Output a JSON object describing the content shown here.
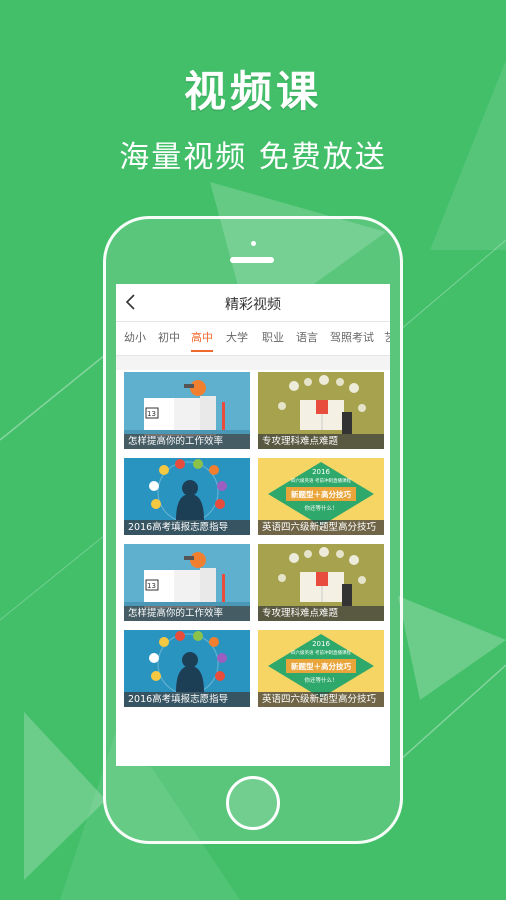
{
  "promo": {
    "headline": "视频课",
    "subhead": "海量视频  免费放送"
  },
  "app": {
    "title": "精彩视频",
    "back_icon": "chevron-left-icon",
    "tabs": [
      {
        "label": "幼小",
        "active": false
      },
      {
        "label": "初中",
        "active": false
      },
      {
        "label": "高中",
        "active": true
      },
      {
        "label": "大学",
        "active": false
      },
      {
        "label": "职业",
        "active": false
      },
      {
        "label": "语言",
        "active": false
      },
      {
        "label": "驾照考试",
        "active": false
      },
      {
        "label": "艺",
        "active": false
      }
    ],
    "videos": [
      {
        "caption": "怎样提高你的工作效率",
        "thumb_number": "13"
      },
      {
        "caption": "专攻理科难点难题"
      },
      {
        "caption": "2016高考填报志愿指导"
      },
      {
        "caption": "英语四六级新题型高分技巧",
        "thumb_year": "2016",
        "thumb_line1": "四六级英语 考前冲刺直播课程",
        "thumb_banner": "新题型＋高分技巧",
        "thumb_line2": "你还等什么！"
      },
      {
        "caption": "怎样提高你的工作效率",
        "thumb_number": "13"
      },
      {
        "caption": "专攻理科难点难题"
      },
      {
        "caption": "2016高考填报志愿指导"
      },
      {
        "caption": "英语四六级新题型高分技巧",
        "thumb_year": "2016",
        "thumb_line1": "四六级英语 考前冲刺直播课程",
        "thumb_banner": "新题型＋高分技巧",
        "thumb_line2": "你还等什么！"
      }
    ]
  },
  "colors": {
    "background": "#43bf6a",
    "active_tab": "#f0692c",
    "thumb_blue": "#5fb0cf",
    "thumb_olive": "#a7a24d",
    "thumb_teal": "#2a94c0",
    "thumb_yellow": "#f6d565"
  }
}
